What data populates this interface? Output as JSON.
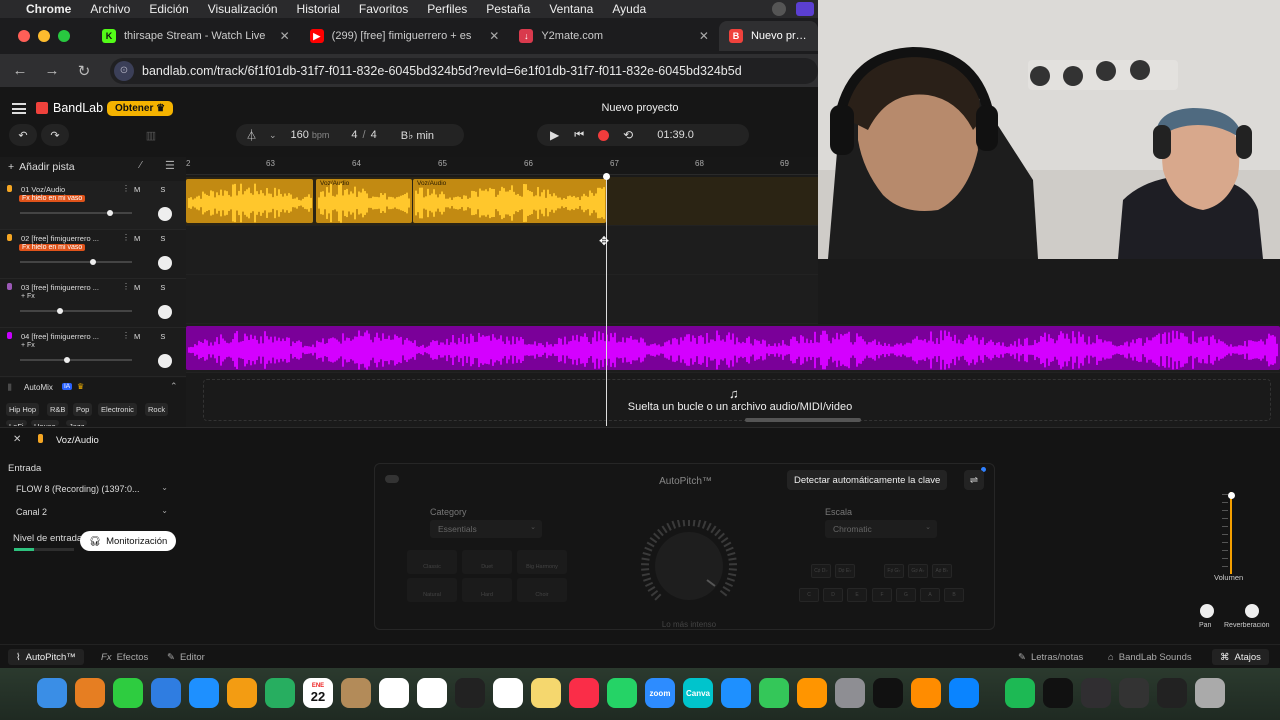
{
  "menubar": {
    "items": [
      "Chrome",
      "Archivo",
      "Edición",
      "Visualización",
      "Historial",
      "Favoritos",
      "Perfiles",
      "Pestaña",
      "Ventana",
      "Ayuda"
    ]
  },
  "tabs": [
    {
      "title": "thirsape Stream - Watch Live",
      "color": "#53fc18",
      "glyph": "K"
    },
    {
      "title": "(299) [free] fimiguerrero + es",
      "color": "#ff0000",
      "glyph": "▶"
    },
    {
      "title": "Y2mate.com",
      "color": "#d93a4d",
      "glyph": "↓"
    },
    {
      "title": "Nuevo proyecto",
      "color": "#f0423c",
      "glyph": "B"
    }
  ],
  "address": {
    "url": "bandlab.com/track/6f1f01db-31f7-f011-832e-6045bd324b5d?revId=6e1f01db-31f7-f011-832e-6045bd324b5d"
  },
  "bandlab": {
    "logo": "BandLab",
    "get_button": "Obtener",
    "project_name": "Nuevo proyecto",
    "bpm": "160",
    "bpm_unit": "bpm",
    "time_sig_num": "4",
    "time_sig_sep": "/",
    "time_sig_den": "4",
    "key": "B♭ min",
    "time": "01:39.0",
    "add_track": "Añadir pista"
  },
  "ruler": {
    "ticks": [
      "2",
      "63",
      "64",
      "65",
      "66",
      "67",
      "68",
      "69"
    ]
  },
  "tracks": [
    {
      "name": "01  Voz/Audio",
      "fx": "Fx hielo en mi vaso",
      "color": "#f5a623"
    },
    {
      "name": "02  [free] fimiguerrero ...",
      "fx": "Fx hielo en mi vaso",
      "color": "#f5a623"
    },
    {
      "name": "03  [free] fimiguerrero ...",
      "fx": "+ Fx",
      "color": "#9b59b6"
    },
    {
      "name": "04  [free] fimiguerrero ...",
      "fx": "+ Fx",
      "color": "#c800ff"
    }
  ],
  "track_volume_levels": [
    0.8,
    0.65,
    0.36,
    0.42
  ],
  "mute_solo": "M S",
  "clips": {
    "label": "Voz/Audio"
  },
  "automix": {
    "title": "AutoMix",
    "ia": "IA",
    "genres": [
      "Hip Hop",
      "R&B",
      "Pop",
      "Electronic",
      "Rock",
      "LoFi",
      "House",
      "Jazz"
    ]
  },
  "drop": {
    "text": "Suelta un bucle o un archivo audio/MIDI/video"
  },
  "panel": {
    "title": "Voz/Audio",
    "input_label": "Entrada",
    "input_device": "FLOW 8 (Recording) (1397:0...",
    "channel": "Canal 2",
    "level_label": "Nivel de entrada",
    "monitor": "Monitorización",
    "input_level": 0.33
  },
  "autopitch": {
    "title": "AutoPitch™",
    "detect": "Detectar automáticamente la clave",
    "category_label": "Category",
    "category_value": "Essentials",
    "scale_label": "Escala",
    "scale_value": "Chromatic",
    "styles": [
      "Classic",
      "Duet",
      "Big Harmony",
      "Natural",
      "Hard",
      "Choir"
    ],
    "keys_top": [
      "C♯ D♭",
      "D♯ E♭",
      "F♯ G♭",
      "G♯ A♭",
      "A♯ B♭"
    ],
    "keys_bottom": [
      "C",
      "D",
      "E",
      "F",
      "G",
      "A",
      "B"
    ],
    "knob_label": "Lo más intenso"
  },
  "mixer": {
    "volume": "Volumen",
    "pan": "Pan",
    "reverb": "Reverberación"
  },
  "footer": {
    "autopitch": "AutoPitch™",
    "effects": "Efectos",
    "editor": "Editor",
    "lyrics": "Letras/notas",
    "sounds": "BandLab Sounds",
    "shortcuts": "Atajos"
  },
  "dock": {
    "calendar_month": "ENE",
    "calendar_day": "22",
    "zoom": "zoom",
    "canva": "Canva",
    "apps": [
      {
        "name": "finder",
        "color": "#3a8ee6"
      },
      {
        "name": "launchpad",
        "color": "#e67e22"
      },
      {
        "name": "messages",
        "color": "#2ecc40"
      },
      {
        "name": "mail",
        "color": "#2f7de1"
      },
      {
        "name": "appstore-safari",
        "color": "#1e90ff"
      },
      {
        "name": "photos",
        "color": "#f39c12"
      },
      {
        "name": "facetime",
        "color": "#27ae60"
      },
      {
        "name": "calendar",
        "color": "#ffffff"
      },
      {
        "name": "contacts",
        "color": "#b38b59"
      },
      {
        "name": "reminders",
        "color": "#ffffff"
      },
      {
        "name": "freeform",
        "color": "#ffffff"
      },
      {
        "name": "chatgpt",
        "color": "#222222"
      },
      {
        "name": "chrome",
        "color": "#ffffff"
      },
      {
        "name": "notes",
        "color": "#f5d76e"
      },
      {
        "name": "music",
        "color": "#fa2d48"
      },
      {
        "name": "whatsapp",
        "color": "#25d366"
      },
      {
        "name": "zoom",
        "color": "#2d8cff"
      },
      {
        "name": "canva",
        "color": "#00c4cc"
      },
      {
        "name": "keynote",
        "color": "#1e90ff"
      },
      {
        "name": "numbers",
        "color": "#34c759"
      },
      {
        "name": "pages",
        "color": "#ff9500"
      },
      {
        "name": "settings",
        "color": "#8e8e93"
      },
      {
        "name": "capcut",
        "color": "#111111"
      },
      {
        "name": "garageband",
        "color": "#ff8c00"
      },
      {
        "name": "app-store",
        "color": "#0a84ff"
      },
      {
        "name": "spotify",
        "color": "#1db954"
      },
      {
        "name": "piano",
        "color": "#111111"
      },
      {
        "name": "obs",
        "color": "#302e31"
      },
      {
        "name": "screenshot-a",
        "color": "#333333"
      },
      {
        "name": "screenshot-b",
        "color": "#222222"
      },
      {
        "name": "trash",
        "color": "#aaaaaa"
      }
    ]
  }
}
